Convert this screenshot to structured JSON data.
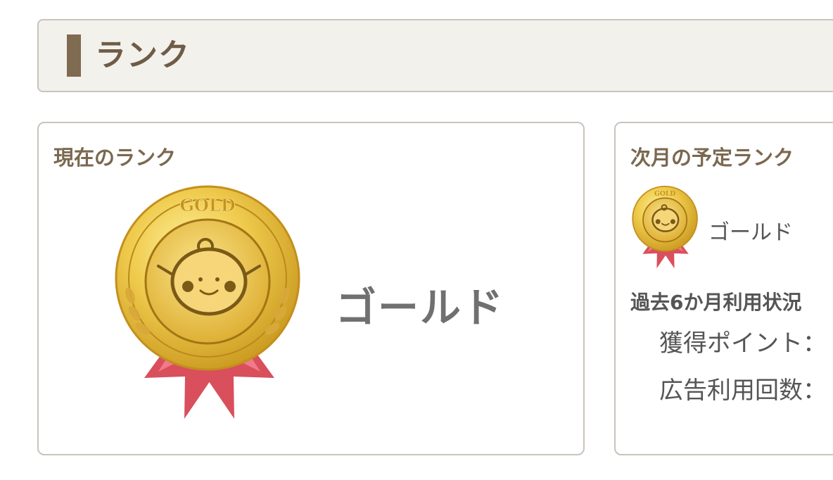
{
  "header": {
    "title": "ランク"
  },
  "current": {
    "title": "現在のランク",
    "medal_text": "GOLD",
    "rank_name": "ゴールド",
    "medal_icon": "gold-medal-icon"
  },
  "next": {
    "title": "次月の予定ランク",
    "medal_text": "GOLD",
    "rank_name": "ゴールド",
    "medal_icon": "gold-medal-icon",
    "usage_title": "過去6か月利用状況",
    "usage": [
      {
        "label": "獲得ポイント："
      },
      {
        "label": "広告利用回数："
      }
    ]
  },
  "colors": {
    "header_bg": "#f3f1ec",
    "header_accent": "#7f6b4f",
    "title_brown": "#6e5c46",
    "ribbon": "#d9525e",
    "gold": "#e2b93b"
  }
}
